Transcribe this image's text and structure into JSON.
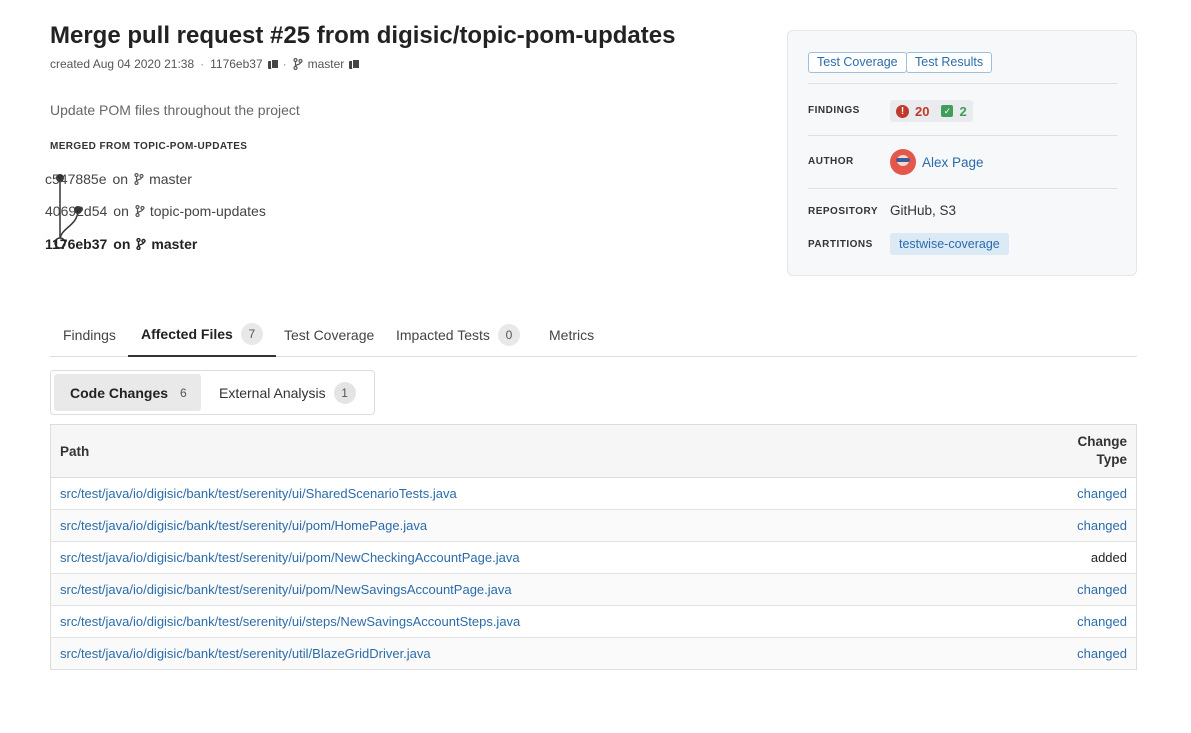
{
  "commit": {
    "title": "Merge pull request #25 from digisic/topic-pom-updates",
    "created": "created Aug 04 2020 21:38",
    "hash": "1176eb37",
    "branch": "master",
    "description": "Update POM files throughout the project",
    "merged_heading": "MERGED FROM TOPIC-POM-UPDATES",
    "history": [
      {
        "hash": "c547885e",
        "on": "on",
        "branch": "master"
      },
      {
        "hash": "40692d54",
        "on": "on",
        "branch": "topic-pom-updates"
      },
      {
        "hash": "1176eb37",
        "on": "on",
        "branch": "master"
      }
    ]
  },
  "sidecard": {
    "chips": [
      "Test Coverage",
      "Test Results"
    ],
    "findings_label": "FINDINGS",
    "findings_errors": "20",
    "findings_ok": "2",
    "author_label": "AUTHOR",
    "author_name": "Alex Page",
    "repository_label": "REPOSITORY",
    "repository_value": "GitHub, S3",
    "partitions_label": "PARTITIONS",
    "partition": "testwise-coverage"
  },
  "tabs": [
    {
      "label": "Findings",
      "count": null
    },
    {
      "label": "Affected Files",
      "count": "7"
    },
    {
      "label": "Test Coverage",
      "count": null
    },
    {
      "label": "Impacted Tests",
      "count": "0"
    },
    {
      "label": "Metrics",
      "count": null
    }
  ],
  "subtabs": [
    {
      "label": "Code Changes",
      "count": "6"
    },
    {
      "label": "External Analysis",
      "count": "1"
    }
  ],
  "table": {
    "col_path": "Path",
    "col_type_1": "Change",
    "col_type_2": "Type",
    "rows": [
      {
        "path": "src/test/java/io/digisic/bank/test/serenity/ui/SharedScenarioTests.java",
        "type": "changed"
      },
      {
        "path": "src/test/java/io/digisic/bank/test/serenity/ui/pom/HomePage.java",
        "type": "changed"
      },
      {
        "path": "src/test/java/io/digisic/bank/test/serenity/ui/pom/NewCheckingAccountPage.java",
        "type": "added"
      },
      {
        "path": "src/test/java/io/digisic/bank/test/serenity/ui/pom/NewSavingsAccountPage.java",
        "type": "changed"
      },
      {
        "path": "src/test/java/io/digisic/bank/test/serenity/ui/steps/NewSavingsAccountSteps.java",
        "type": "changed"
      },
      {
        "path": "src/test/java/io/digisic/bank/test/serenity/util/BlazeGridDriver.java",
        "type": "changed"
      }
    ]
  },
  "colors": {
    "link": "#2b6bab",
    "error": "#c0392b",
    "ok": "#3f9e5a"
  }
}
